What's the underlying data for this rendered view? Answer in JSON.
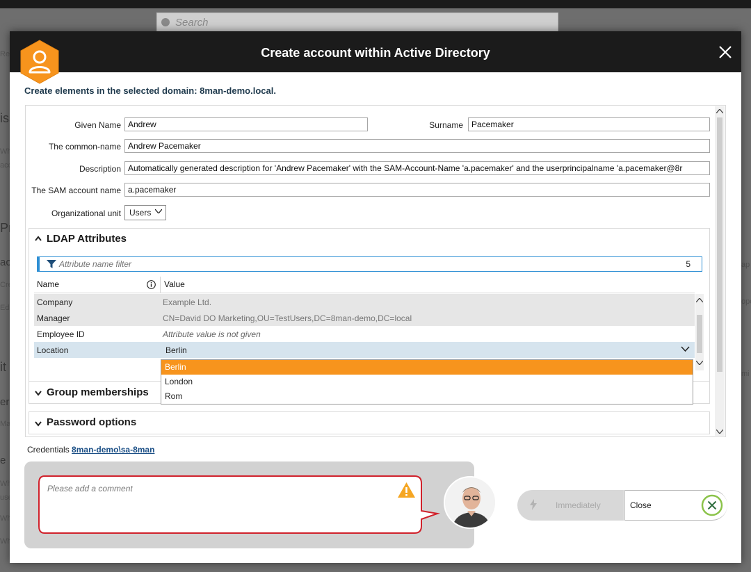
{
  "background": {
    "search_placeholder": "Search",
    "fragments": [
      "Res",
      "iss",
      "Wh",
      "acc",
      "Pr",
      "acc",
      "Cre",
      "Edi",
      "it",
      "er",
      "Ma",
      "e",
      "Wh",
      "use",
      "Wh",
      "Wh",
      "ap",
      "ope",
      "mi"
    ]
  },
  "dialog": {
    "title": "Create account within Active Directory",
    "subtitle": "Create elements in the selected domain: 8man-demo.local."
  },
  "form": {
    "given_name_label": "Given Name",
    "given_name_value": "Andrew",
    "surname_label": "Surname",
    "surname_value": "Pacemaker",
    "common_name_label": "The common-name",
    "common_name_value": "Andrew Pacemaker",
    "description_label": "Description",
    "description_value": "Automatically generated description for 'Andrew Pacemaker' with the SAM-Account-Name 'a.pacemaker' and the userprincipalname 'a.pacemaker@8r",
    "sam_label": "The SAM account name",
    "sam_value": "a.pacemaker",
    "ou_label": "Organizational unit",
    "ou_value": "Users"
  },
  "ldap": {
    "header": "LDAP Attributes",
    "filter_placeholder": "Attribute name filter",
    "filter_count": "5",
    "col_name": "Name",
    "col_value": "Value",
    "rows": [
      {
        "name": "Company",
        "value": "Example Ltd."
      },
      {
        "name": "Manager",
        "value": "CN=David DO Marketing,OU=TestUsers,DC=8man-demo,DC=local"
      },
      {
        "name": "Employee ID",
        "value": "Attribute value is not given"
      },
      {
        "name": "Location",
        "value": "Berlin"
      }
    ],
    "dropdown_options": [
      "Berlin",
      "London",
      "Rom"
    ]
  },
  "sections": {
    "group_memberships": "Group memberships",
    "password_options": "Password options"
  },
  "credentials": {
    "label": "Credentials",
    "account": "8man-demo\\sa-8man"
  },
  "comment": {
    "placeholder": "Please add a comment"
  },
  "actions": {
    "immediately_label": "Immediately",
    "close_label": "Close"
  },
  "colors": {
    "accent_orange": "#f7941d",
    "selected_row": "#d6e4ee",
    "titlebar": "#1b1b1b",
    "filter_blue": "#2e8fd4",
    "error_red": "#d0212b",
    "close_ring_green": "#8bc34a"
  }
}
